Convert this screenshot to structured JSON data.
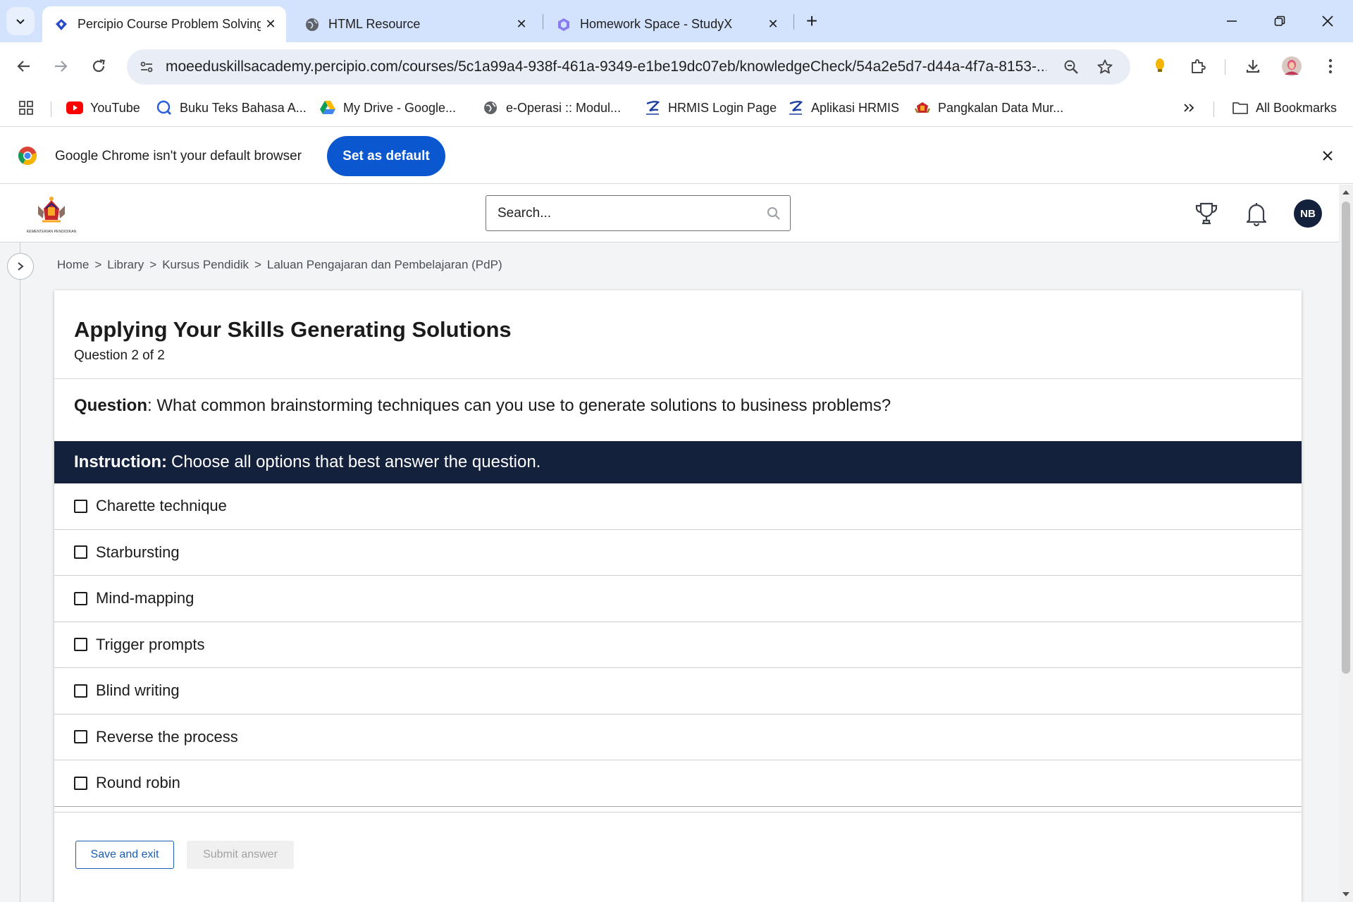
{
  "tabs": [
    {
      "title": "Percipio Course Problem Solving",
      "active": true,
      "icon": "percipio-favicon"
    },
    {
      "title": "HTML Resource",
      "active": false,
      "icon": "globe-favicon"
    },
    {
      "title": "Homework Space - StudyX",
      "active": false,
      "icon": "studyx-favicon"
    }
  ],
  "address_bar": {
    "url": "moeeduskillsacademy.percipio.com/courses/5c1a99a4-938f-461a-9349-e1be19dc07eb/knowledgeCheck/54a2e5d7-d44a-4f7a-8153-..."
  },
  "bookmarks": [
    {
      "label": "YouTube",
      "icon": "youtube-icon"
    },
    {
      "label": "Buku Teks Bahasa A...",
      "icon": "search-favicon"
    },
    {
      "label": "My Drive - Google...",
      "icon": "drive-icon"
    },
    {
      "label": "e-Operasi :: Modul...",
      "icon": "globe-icon"
    },
    {
      "label": "HRMIS Login Page",
      "icon": "hrmis-icon"
    },
    {
      "label": "Aplikasi HRMIS",
      "icon": "hrmis-icon"
    },
    {
      "label": "Pangkalan Data Mur...",
      "icon": "crest-icon"
    }
  ],
  "all_bookmarks_label": "All Bookmarks",
  "infobar": {
    "message": "Google Chrome isn't your default browser",
    "button": "Set as default"
  },
  "site": {
    "logo_caption": "KEMENTERIAN PENDIDIKAN",
    "search_placeholder": "Search...",
    "avatar_initials": "NB"
  },
  "breadcrumb": [
    "Home",
    "Library",
    "Kursus Pendidik",
    "Laluan Pengajaran dan Pembelajaran (PdP)"
  ],
  "breadcrumb_separator": ">",
  "quiz": {
    "title": "Applying Your Skills Generating Solutions",
    "progress": "Question 2 of 2",
    "question_label": "Question",
    "question_text": ": What common brainstorming techniques can you use to generate solutions to business problems?",
    "instruction_label": "Instruction:",
    "instruction_text": "Choose all options that best answer the question.",
    "options": [
      {
        "label": "Charette technique",
        "checked": false
      },
      {
        "label": "Starbursting",
        "checked": false
      },
      {
        "label": "Mind-mapping",
        "checked": false
      },
      {
        "label": "Trigger prompts",
        "checked": false
      },
      {
        "label": "Blind writing",
        "checked": false
      },
      {
        "label": "Reverse the process",
        "checked": false
      },
      {
        "label": "Round robin",
        "checked": false
      }
    ],
    "save_button": "Save and exit",
    "submit_button": "Submit answer"
  },
  "colors": {
    "navy": "#14213d",
    "chrome_tabstrip": "#d3e3fd",
    "chrome_blue": "#0b57d0",
    "link_blue": "#1a5fb4"
  }
}
